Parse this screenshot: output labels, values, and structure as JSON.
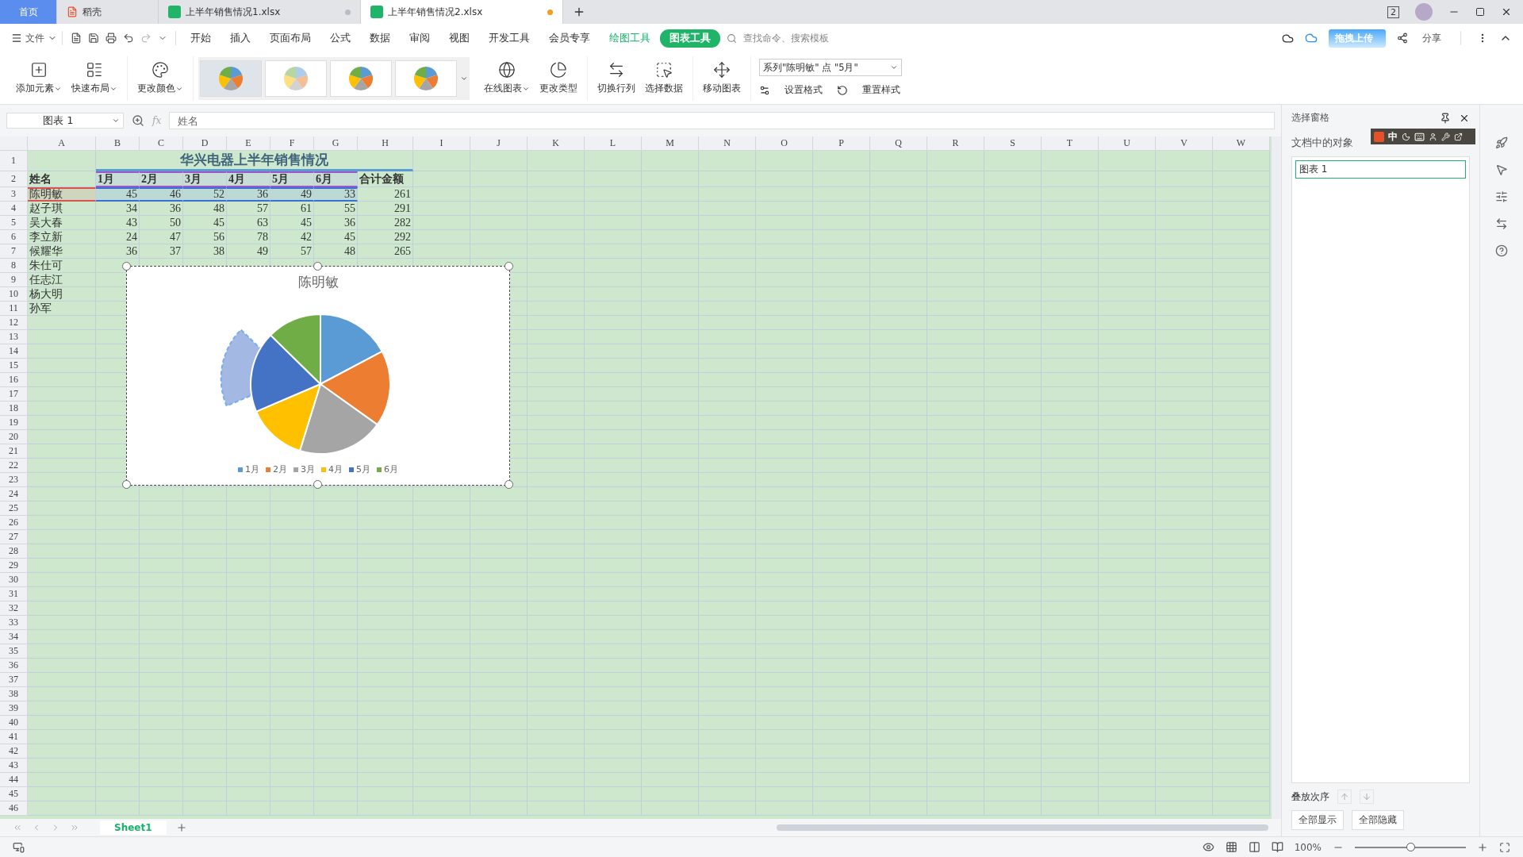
{
  "tabs": [
    {
      "label": "首页",
      "selected": true,
      "kind": "home"
    },
    {
      "label": "稻壳",
      "selected": false,
      "kind": "app"
    },
    {
      "label": "上半年销售情况1.xlsx",
      "selected": false,
      "kind": "sheet",
      "modified": false
    },
    {
      "label": "上半年销售情况2.xlsx",
      "selected": true,
      "kind": "sheet",
      "modified": true
    }
  ],
  "title_bar": {
    "window_count": "2"
  },
  "menu": {
    "file": "文件",
    "items": [
      {
        "label": "开始",
        "selected": false,
        "kind": "plain"
      },
      {
        "label": "插入",
        "selected": false,
        "kind": "plain"
      },
      {
        "label": "页面布局",
        "selected": false,
        "kind": "plain"
      },
      {
        "label": "公式",
        "selected": false,
        "kind": "plain"
      },
      {
        "label": "数据",
        "selected": false,
        "kind": "plain"
      },
      {
        "label": "审阅",
        "selected": false,
        "kind": "plain"
      },
      {
        "label": "视图",
        "selected": false,
        "kind": "plain"
      },
      {
        "label": "开发工具",
        "selected": false,
        "kind": "plain"
      },
      {
        "label": "会员专享",
        "selected": false,
        "kind": "plain"
      },
      {
        "label": "绘图工具",
        "selected": false,
        "kind": "context"
      },
      {
        "label": "图表工具",
        "selected": true,
        "kind": "context"
      }
    ],
    "search_placeholder": "查找命令、搜索模板",
    "upload": "拖拽上传",
    "share": "分享"
  },
  "ribbon": {
    "groups": [
      [
        {
          "label": "添加元素",
          "dropdown": true
        },
        {
          "label": "快速布局",
          "dropdown": true
        }
      ],
      [
        {
          "label": "更改颜色",
          "dropdown": true
        }
      ]
    ],
    "styles": [
      {
        "selected": true
      },
      {
        "selected": false
      },
      {
        "selected": false
      },
      {
        "selected": false
      }
    ],
    "groups2": [
      [
        {
          "label": "在线图表",
          "dropdown": true
        },
        {
          "label": "更改类型",
          "dropdown": false
        }
      ],
      [
        {
          "label": "切换行列",
          "dropdown": false
        },
        {
          "label": "选择数据",
          "dropdown": false
        }
      ],
      [
        {
          "label": "移动图表",
          "dropdown": false
        }
      ]
    ],
    "element_select": "系列\"陈明敏\" 点 \"5月\"",
    "format": "设置格式",
    "reset": "重置样式"
  },
  "formula_bar": {
    "name_box": "图表 1",
    "fx": "fx",
    "value": "姓名"
  },
  "sheet": {
    "columns": [
      "A",
      "B",
      "C",
      "D",
      "E",
      "F",
      "G",
      "H",
      "I",
      "J",
      "K",
      "L",
      "M",
      "N",
      "O",
      "P",
      "Q",
      "R",
      "S",
      "T",
      "U",
      "V",
      "W"
    ],
    "row_numbers": [
      "1",
      "2",
      "3",
      "4",
      "5",
      "6",
      "7",
      "8",
      "9",
      "10",
      "11",
      "12",
      "13",
      "14",
      "15",
      "16",
      "17",
      "18",
      "19",
      "20",
      "21",
      "22",
      "23",
      "24",
      "25",
      "26",
      "27",
      "28",
      "29",
      "30",
      "31",
      "32",
      "33",
      "34",
      "35",
      "36",
      "37",
      "38",
      "39",
      "40",
      "41",
      "42",
      "43",
      "44",
      "45",
      "46"
    ],
    "title": "华兴电器上半年销售情况",
    "header": [
      "姓名",
      "1月",
      "2月",
      "3月",
      "4月",
      "5月",
      "6月",
      "合计金额"
    ],
    "rows": [
      {
        "selected": true,
        "cells": [
          "陈明敏",
          "45",
          "46",
          "52",
          "36",
          "49",
          "33",
          "261"
        ]
      },
      {
        "selected": false,
        "cells": [
          "赵子琪",
          "34",
          "36",
          "48",
          "57",
          "61",
          "55",
          "291"
        ]
      },
      {
        "selected": false,
        "cells": [
          "吴大春",
          "43",
          "50",
          "45",
          "63",
          "45",
          "36",
          "282"
        ]
      },
      {
        "selected": false,
        "cells": [
          "李立新",
          "24",
          "47",
          "56",
          "78",
          "42",
          "45",
          "292"
        ]
      },
      {
        "selected": false,
        "cells": [
          "候耀华",
          "36",
          "37",
          "38",
          "49",
          "57",
          "48",
          "265"
        ]
      },
      {
        "selected": false,
        "cells": [
          "朱仕可"
        ]
      },
      {
        "selected": false,
        "cells": [
          "任志江"
        ]
      },
      {
        "selected": false,
        "cells": [
          "杨大明"
        ]
      },
      {
        "selected": false,
        "cells": [
          "孙军"
        ]
      }
    ]
  },
  "chart": {
    "selected": true,
    "slice_selected": [
      false,
      false,
      false,
      false,
      true,
      false
    ],
    "chart_data": {
      "type": "pie",
      "title": "陈明敏",
      "categories": [
        "1月",
        "2月",
        "3月",
        "4月",
        "5月",
        "6月"
      ],
      "values": [
        17.24,
        17.62,
        19.92,
        13.79,
        18.77,
        12.66
      ],
      "colors": [
        "#5b9bd5",
        "#ed7d31",
        "#a5a5a5",
        "#ffc000",
        "#4472c4",
        "#70ad47"
      ]
    }
  },
  "sheet_tabs": [
    {
      "label": "Sheet1",
      "selected": true
    }
  ],
  "selection_pane": {
    "title": "选择窗格",
    "section": "文档中的对象",
    "objects": [
      {
        "label": "图表 1",
        "selected": true
      }
    ],
    "order_label": "叠放次序",
    "show_all": "全部显示",
    "hide_all": "全部隐藏"
  },
  "ime_bar": {
    "mode": "中"
  },
  "status_bar": {
    "zoom": "100%",
    "zoom_slider": {
      "level": 0.5
    }
  }
}
